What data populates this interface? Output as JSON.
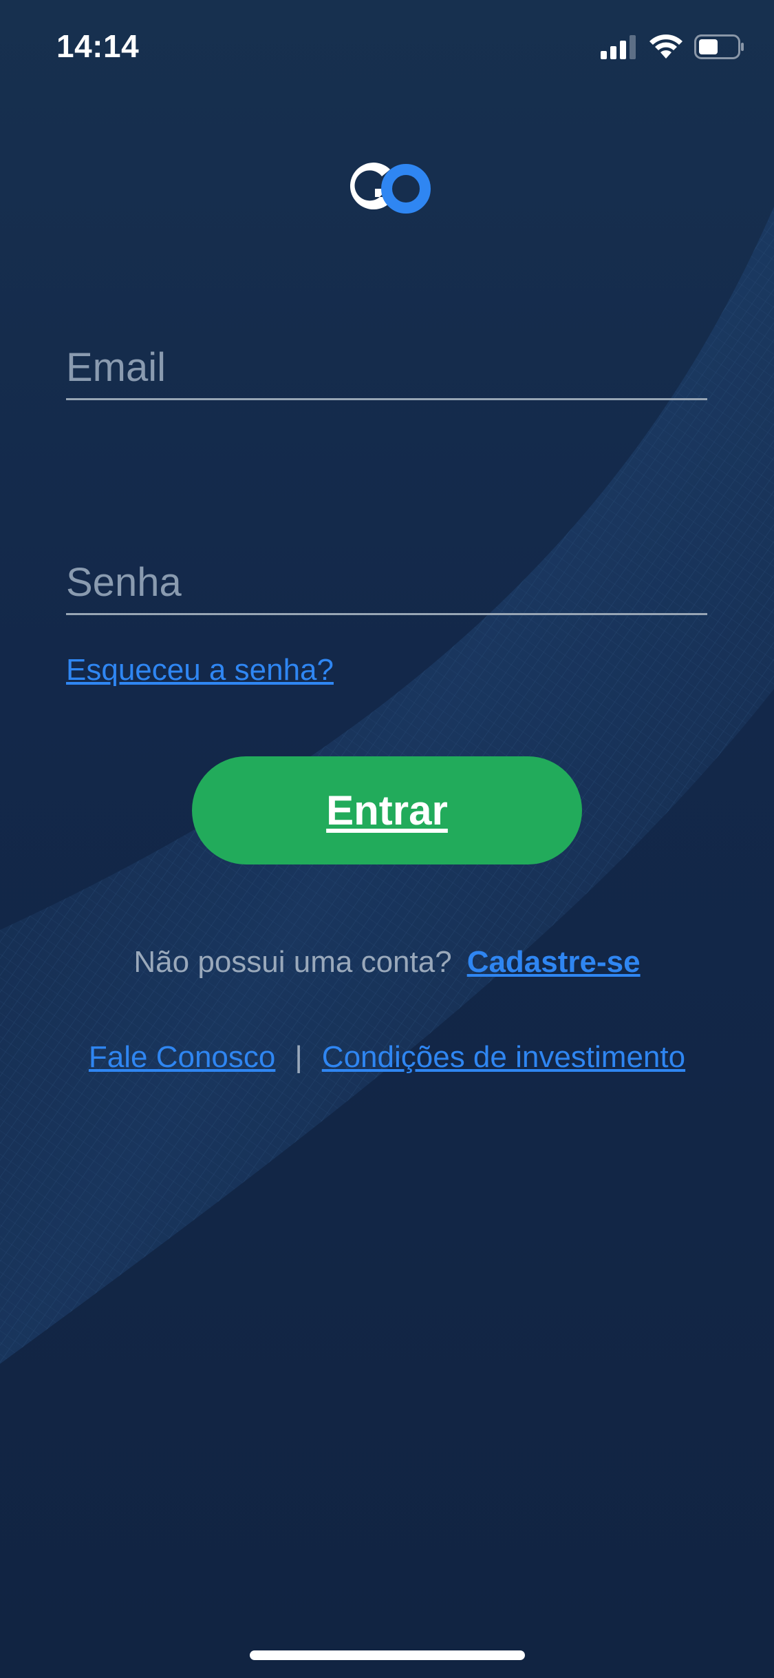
{
  "status_bar": {
    "time": "14:14",
    "icons": [
      "cellular-signal-icon",
      "wifi-icon",
      "battery-icon"
    ]
  },
  "logo": {
    "name": "go-logo",
    "colors": {
      "g": "#ffffff",
      "o": "#2f86f2"
    }
  },
  "form": {
    "email_placeholder": "Email",
    "email_value": "",
    "password_placeholder": "Senha",
    "password_value": "",
    "forgot_password": "Esqueceu a senha?",
    "submit_label": "Entrar"
  },
  "signup": {
    "prompt": "Não possui uma conta?",
    "link": "Cadastre-se"
  },
  "footer": {
    "contact": "Fale Conosco",
    "separator": "|",
    "terms": "Condições de investimento"
  },
  "colors": {
    "background": "#152b4a",
    "accent": "#2f86f2",
    "primary_button": "#22ab5b",
    "muted_text": "#9aa9bb"
  }
}
